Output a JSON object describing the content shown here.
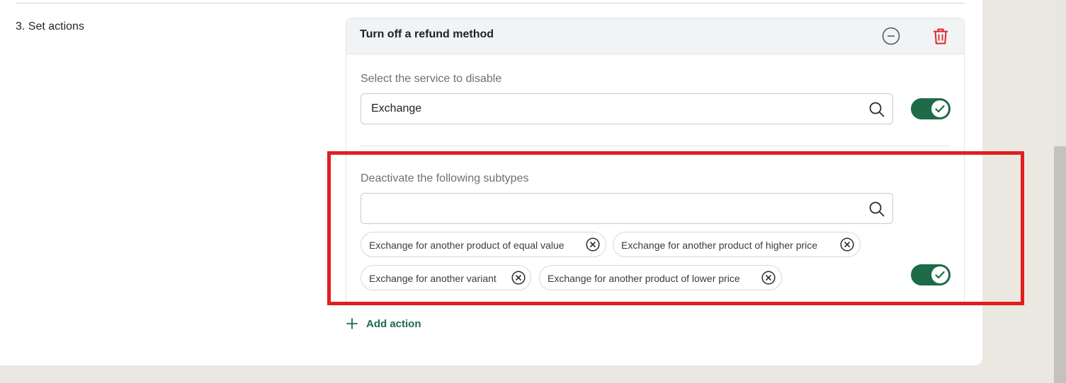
{
  "section": {
    "title": "3. Set actions"
  },
  "action_card": {
    "title": "Turn off a refund method",
    "collapse_icon": "minus-circle-icon",
    "delete_icon": "trash-icon",
    "service_field": {
      "label": "Select the service to disable",
      "value": "Exchange",
      "placeholder": "",
      "toggle_on": true
    },
    "subtypes_field": {
      "label": "Deactivate the following subtypes",
      "value": "",
      "placeholder": "",
      "toggle_on": true,
      "chips": [
        "Exchange for another product of equal value",
        "Exchange for another product of higher price",
        "Exchange for another variant",
        "Exchange for another product of lower price"
      ]
    }
  },
  "add_action": {
    "label": "Add action"
  },
  "colors": {
    "accent_green": "#1e6b4a",
    "delete_red": "#e0262b",
    "highlight_red": "#e01e1e",
    "page_background": "#ebe8e1"
  }
}
